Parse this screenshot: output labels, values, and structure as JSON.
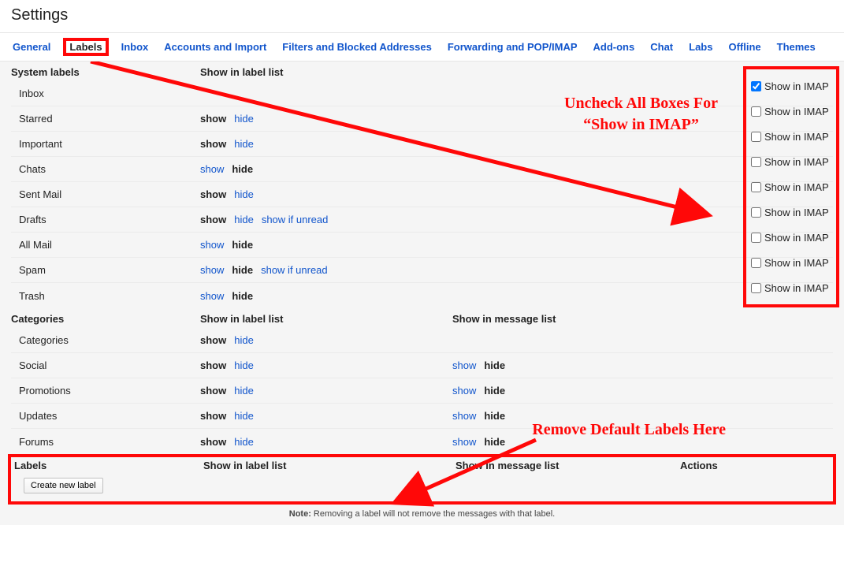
{
  "pageTitle": "Settings",
  "tabs": [
    {
      "label": "General",
      "active": false
    },
    {
      "label": "Labels",
      "active": true
    },
    {
      "label": "Inbox",
      "active": false
    },
    {
      "label": "Accounts and Import",
      "active": false
    },
    {
      "label": "Filters and Blocked Addresses",
      "active": false
    },
    {
      "label": "Forwarding and POP/IMAP",
      "active": false
    },
    {
      "label": "Add-ons",
      "active": false
    },
    {
      "label": "Chat",
      "active": false
    },
    {
      "label": "Labs",
      "active": false
    },
    {
      "label": "Offline",
      "active": false
    },
    {
      "label": "Themes",
      "active": false
    }
  ],
  "sections": {
    "system": {
      "title": "System labels",
      "colLabel": "Show in label list",
      "rows": [
        {
          "name": "Inbox",
          "show": null,
          "hide": null,
          "extra": null
        },
        {
          "name": "Starred",
          "show": "bold",
          "hide": "link",
          "extra": null
        },
        {
          "name": "Important",
          "show": "bold",
          "hide": "link",
          "extra": null
        },
        {
          "name": "Chats",
          "show": "link",
          "hide": "bold",
          "extra": null
        },
        {
          "name": "Sent Mail",
          "show": "bold",
          "hide": "link",
          "extra": null
        },
        {
          "name": "Drafts",
          "show": "bold",
          "hide": "link",
          "extra": "show if unread"
        },
        {
          "name": "All Mail",
          "show": "link",
          "hide": "bold",
          "extra": null
        },
        {
          "name": "Spam",
          "show": "link",
          "hide": "bold",
          "extra": "show if unread"
        },
        {
          "name": "Trash",
          "show": "link",
          "hide": "bold",
          "extra": null
        }
      ]
    },
    "categories": {
      "title": "Categories",
      "colLabel": "Show in label list",
      "colMsg": "Show in message list",
      "rows": [
        {
          "name": "Categories",
          "show": "bold",
          "hide": "link",
          "mshow": null,
          "mhide": null
        },
        {
          "name": "Social",
          "show": "bold",
          "hide": "link",
          "mshow": "link",
          "mhide": "bold"
        },
        {
          "name": "Promotions",
          "show": "bold",
          "hide": "link",
          "mshow": "link",
          "mhide": "bold"
        },
        {
          "name": "Updates",
          "show": "bold",
          "hide": "link",
          "mshow": "link",
          "mhide": "bold"
        },
        {
          "name": "Forums",
          "show": "bold",
          "hide": "link",
          "mshow": "link",
          "mhide": "bold"
        }
      ]
    },
    "labels": {
      "title": "Labels",
      "colLabel": "Show in label list",
      "colMsg": "Show in message list",
      "colActions": "Actions",
      "buttonLabel": "Create new label"
    }
  },
  "strings": {
    "show": "show",
    "hide": "hide",
    "showInImap": "Show in IMAP"
  },
  "imap": [
    {
      "checked": true
    },
    {
      "checked": false
    },
    {
      "checked": false
    },
    {
      "checked": false
    },
    {
      "checked": false
    },
    {
      "checked": false
    },
    {
      "checked": false
    },
    {
      "checked": false
    },
    {
      "checked": false
    }
  ],
  "note": {
    "bold": "Note:",
    "text": " Removing a label will not remove the messages with that label."
  },
  "annotations": {
    "a1": "Uncheck All Boxes For\n“Show in IMAP”",
    "a2": "Remove Default Labels Here"
  }
}
